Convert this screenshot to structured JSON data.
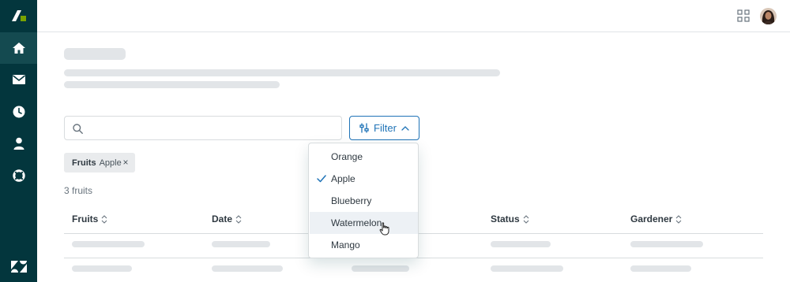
{
  "sidebar": {
    "items": [
      {
        "icon": "home-icon",
        "active": true
      },
      {
        "icon": "mail-icon",
        "active": false
      },
      {
        "icon": "clock-icon",
        "active": false
      },
      {
        "icon": "user-icon",
        "active": false
      },
      {
        "icon": "support-icon",
        "active": false
      }
    ]
  },
  "search": {
    "value": "",
    "placeholder": ""
  },
  "filter": {
    "label": "Filter"
  },
  "active_tag": {
    "key": "Fruits",
    "value": "Apple",
    "remove": "×"
  },
  "result_count": "3 fruits",
  "table": {
    "columns": [
      "Fruits",
      "Date",
      "Status",
      "Gardener"
    ]
  },
  "dropdown": {
    "options": [
      "Orange",
      "Apple",
      "Blueberry",
      "Watermelon",
      "Mango"
    ],
    "selected": "Apple",
    "hovered": "Watermelon"
  },
  "colors": {
    "sidebar": "#03363d",
    "accent": "#1f73b7",
    "skeleton": "#e2e5e8"
  }
}
